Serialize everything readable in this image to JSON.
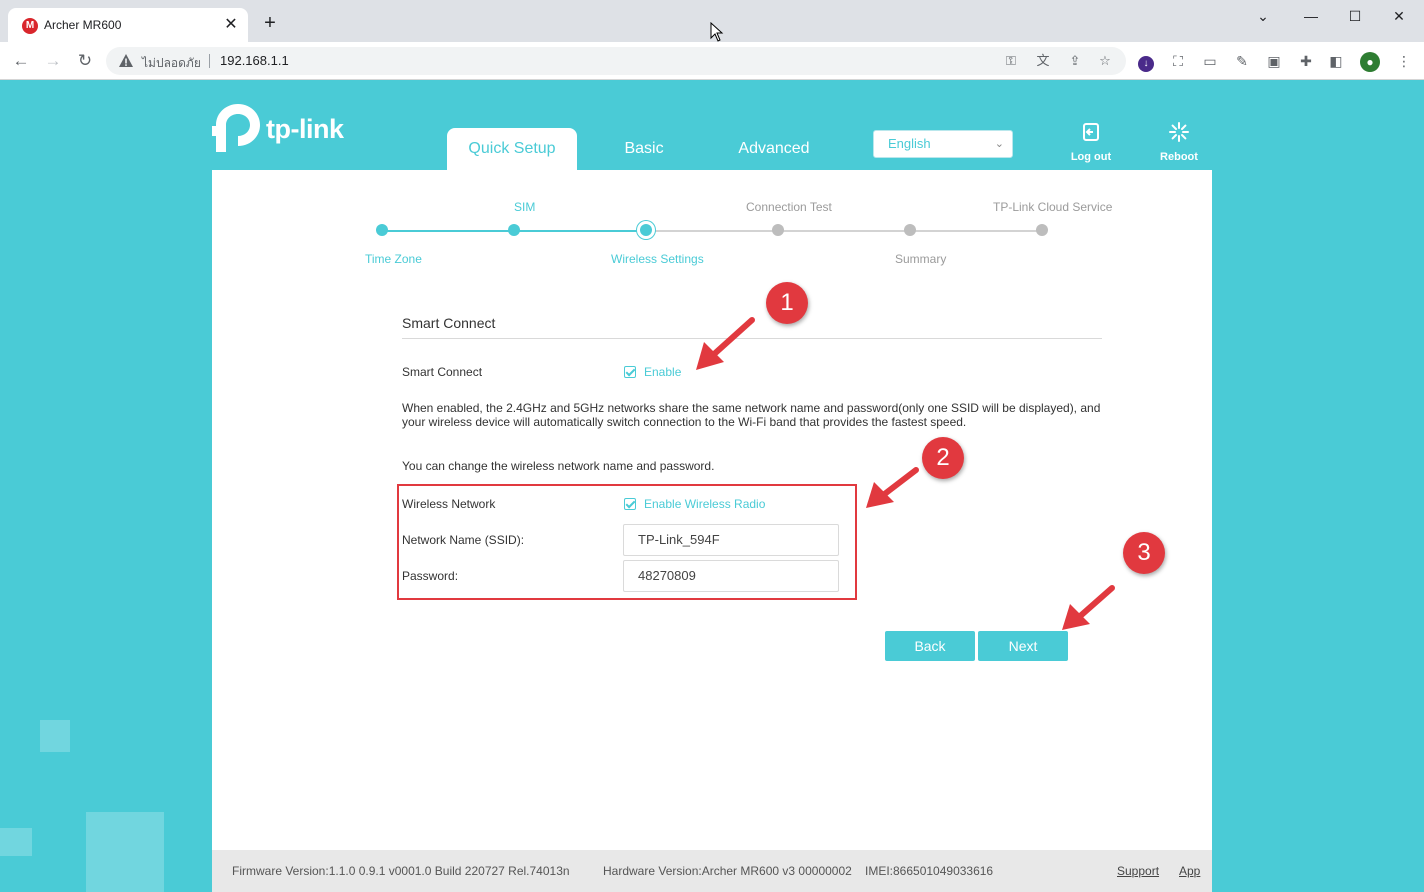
{
  "browser": {
    "tab_title": "Archer MR600",
    "tab_favicon": "M",
    "insecure_label": "ไม่ปลอดภัย",
    "url": "192.168.1.1"
  },
  "header": {
    "logo_text": "tp-link",
    "tabs": [
      {
        "label": "Quick Setup",
        "active": true
      },
      {
        "label": "Basic",
        "active": false
      },
      {
        "label": "Advanced",
        "active": false
      }
    ],
    "language": "English",
    "logout_label": "Log out",
    "reboot_label": "Reboot"
  },
  "steps": {
    "top_labels": [
      "SIM",
      "Connection Test",
      "TP-Link Cloud Service"
    ],
    "bottom_labels": [
      "Time Zone",
      "Wireless Settings",
      "Summary"
    ]
  },
  "form": {
    "section_title": "Smart Connect",
    "smart_connect_label": "Smart Connect",
    "smart_connect_check_label": "Enable",
    "description": "When enabled, the 2.4GHz and 5GHz networks share the same network name and password(only one SSID will be displayed), and your wireless device will automatically switch connection to the Wi-Fi band that provides the fastest speed.",
    "change_note": "You can change the wireless network name and password.",
    "wireless_network_label": "Wireless Network",
    "wireless_radio_label": "Enable Wireless Radio",
    "ssid_label": "Network Name (SSID):",
    "ssid_value": "TP-Link_594F",
    "password_label": "Password:",
    "password_value": "48270809",
    "back_label": "Back",
    "next_label": "Next"
  },
  "footer": {
    "firmware": "Firmware Version:1.1.0 0.9.1 v0001.0 Build 220727 Rel.74013n",
    "hardware": "Hardware Version:Archer MR600 v3 00000002",
    "imei": "IMEI:866501049033616",
    "support": "Support",
    "app": "App"
  },
  "annotations": [
    "1",
    "2",
    "3"
  ],
  "colors": {
    "accent": "#4acbd6",
    "annotation": "#e1393f"
  }
}
